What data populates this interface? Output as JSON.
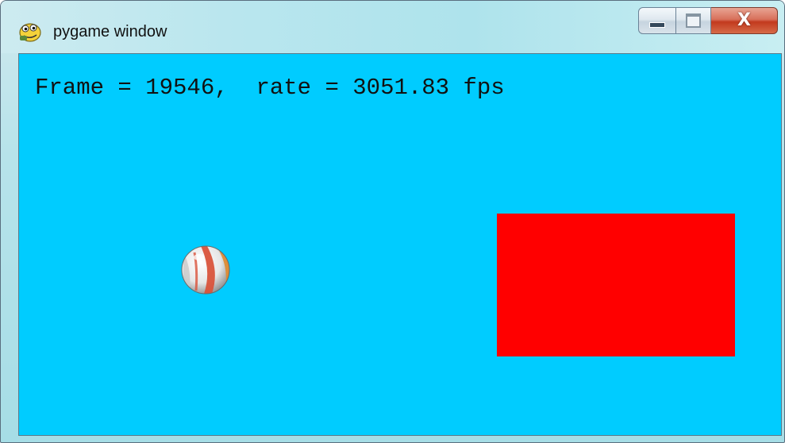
{
  "window": {
    "title": "pygame window",
    "icon": "pygame-snake-icon",
    "controls": {
      "minimize_icon": "minimize-icon",
      "maximize_icon": "maximize-icon",
      "close_label": "X"
    }
  },
  "game": {
    "background_color": "#00ccff",
    "hud": {
      "text": "Frame = 19546,  rate = 3051.83 fps",
      "frame": 19546,
      "rate_fps": 3051.83
    },
    "sprites": {
      "ball": {
        "icon": "beach-ball-icon"
      },
      "rectangle": {
        "color": "#ff0000"
      }
    }
  }
}
